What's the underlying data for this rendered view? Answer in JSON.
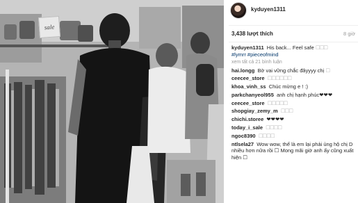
{
  "post": {
    "username": "kyduyen1311",
    "likes": "3,438 lượt thích",
    "time": "8 giờ",
    "caption_user": "kyduyen1311",
    "caption_text": "His back... Feel safe",
    "caption_emoji": "☐☐☐",
    "caption_tags": "#lymrr #pieceofmind",
    "view_all": "xem tất cả 21 bình luận"
  },
  "photo": {
    "store_sign": "sale"
  },
  "comments": [
    {
      "user": "hai.longg",
      "text": "Bờ vai vững chắc đâyyyy chị",
      "emoji": "☐"
    },
    {
      "user": "ceecee_store",
      "text": "",
      "emoji": "☐☐☐☐☐☐"
    },
    {
      "user": "khoa_vinh_ss",
      "text": "Chúc mừng e ! :)",
      "emoji": ""
    },
    {
      "user": "parkchanyeol955",
      "text": "anh chị hạnh phúc❤❤❤",
      "emoji": ""
    },
    {
      "user": "ceecee_store",
      "text": "",
      "emoji": "☐☐☐☐☐"
    },
    {
      "user": "shopgiay_zemy_m",
      "text": "",
      "emoji": "☐☐☐"
    },
    {
      "user": "chichi.storee",
      "text": "❤❤❤❤",
      "emoji": ""
    },
    {
      "user": "today_i_sale",
      "text": "",
      "emoji": "☐☐☐☐"
    },
    {
      "user": "ngoc8390",
      "text": "",
      "emoji": "☐☐☐☐"
    },
    {
      "user": "ntlsela27",
      "text": "Wow wow, thế là em lại phải ủng hộ chị D nhiều hơn nữa rồi ☐ Mong mãi giờ anh ấy cũng xuất hiện ☐",
      "emoji": ""
    }
  ]
}
